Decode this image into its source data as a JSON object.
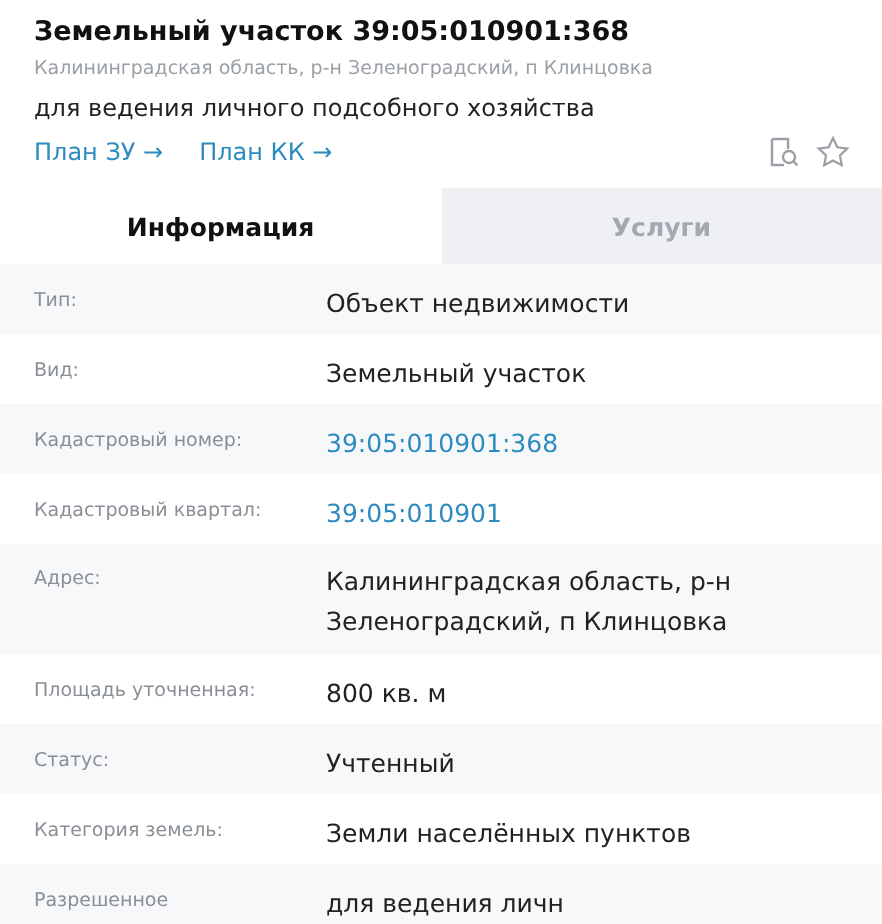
{
  "header": {
    "title": "Земельный участок 39:05:010901:368",
    "address": "Калининградская область, р-н Зеленоградский, п Клинцовка",
    "purpose": "для ведения личного подсобного хозяйства",
    "links": [
      "План ЗУ →",
      "План КК →"
    ]
  },
  "tabs": [
    {
      "label": "Информация",
      "selected": true
    },
    {
      "label": "Услуги",
      "selected": false
    }
  ],
  "rows": [
    {
      "label": "Тип:",
      "value": "Объект недвижимости",
      "kind": "text"
    },
    {
      "label": "Вид:",
      "value": "Земельный участок",
      "kind": "text"
    },
    {
      "label": "Кадастровый номер:",
      "value": "39:05:010901:368",
      "kind": "link"
    },
    {
      "label": "Кадастровый квартал:",
      "value": "39:05:010901",
      "kind": "link"
    },
    {
      "label": "Адрес:",
      "value": "Калининградская область, р-н Зеленоградский, п Клинцовка",
      "kind": "text"
    },
    {
      "label": "Площадь уточненная:",
      "value": "800 кв. м",
      "kind": "text"
    },
    {
      "label": "Статус:",
      "value": "Учтенный",
      "kind": "text"
    },
    {
      "label": "Категория земель:",
      "value": "Земли населённых пунктов",
      "kind": "text"
    },
    {
      "label": "Разрешенное",
      "value": "для ведения личн",
      "kind": "text"
    }
  ]
}
